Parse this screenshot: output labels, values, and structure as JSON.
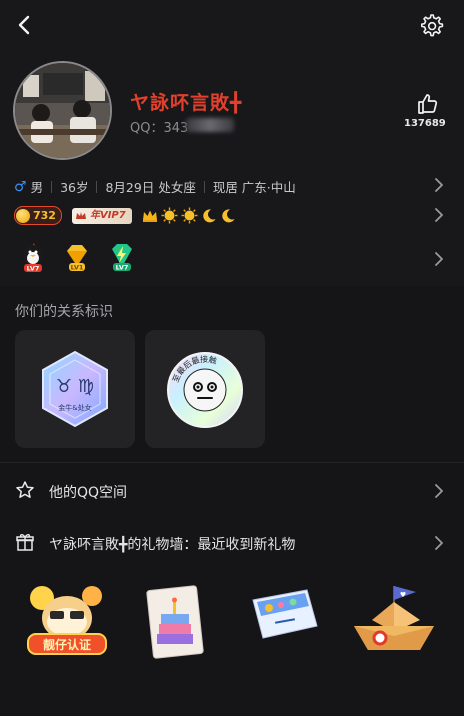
{
  "profile": {
    "nickname": "ヤ詠吥言敗╋",
    "qq_label": "QQ：343",
    "likes": "137689"
  },
  "info": {
    "gender_symbol": "♂",
    "gender": "男",
    "age": "36岁",
    "birthday": "8月29日 处女座",
    "location": "现居 广东·中山"
  },
  "badges": {
    "coin_value": "732",
    "vip_label": "年VIP7",
    "level_badges": [
      "LV7",
      "LV1",
      "LV7"
    ]
  },
  "relation": {
    "section_title": "你们的关系标识",
    "card1_label": "金牛&处女",
    "card2_ring_text": "至最后最接触"
  },
  "links": {
    "qzone": "他的QQ空间",
    "giftwall": "ヤ詠吥言敗╋的礼物墙：最近收到新礼物"
  },
  "gifts": {
    "gift1_text": "靓仔认证"
  },
  "colors": {
    "background": "#151517",
    "nickname": "#e0402c",
    "vip": "#c23a2a",
    "coin": "#f6c02c"
  }
}
